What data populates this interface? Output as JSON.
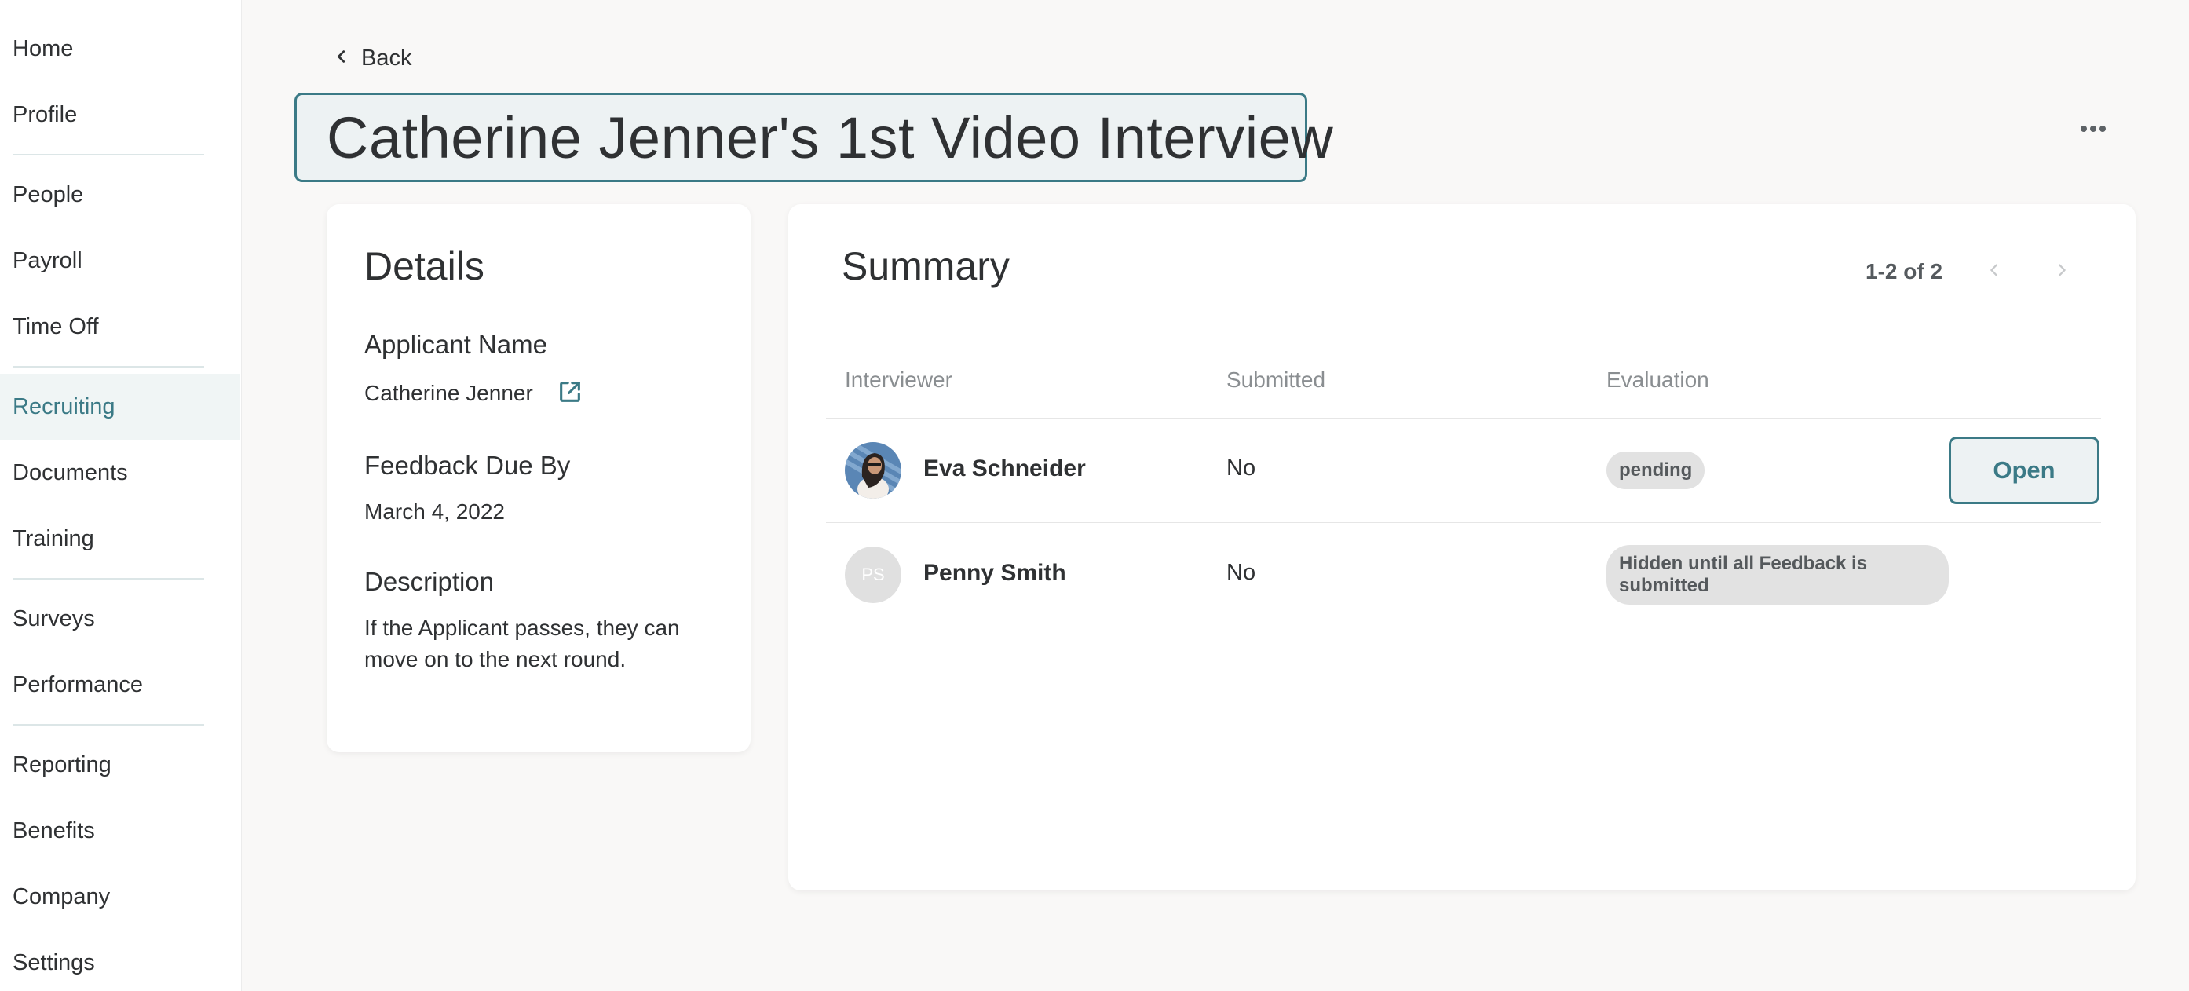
{
  "sidebar": {
    "items": [
      {
        "label": "Home"
      },
      {
        "label": "Profile"
      },
      {
        "label": "People"
      },
      {
        "label": "Payroll"
      },
      {
        "label": "Time Off"
      },
      {
        "label": "Recruiting"
      },
      {
        "label": "Documents"
      },
      {
        "label": "Training"
      },
      {
        "label": "Surveys"
      },
      {
        "label": "Performance"
      },
      {
        "label": "Reporting"
      },
      {
        "label": "Benefits"
      },
      {
        "label": "Company"
      },
      {
        "label": "Settings"
      }
    ],
    "active_item": "Recruiting"
  },
  "header": {
    "back_label": "Back",
    "title": "Catherine Jenner's 1st Video Interview",
    "more_icon": "more-horizontal-icon"
  },
  "details": {
    "title": "Details",
    "applicant_label": "Applicant Name",
    "applicant_value": "Catherine Jenner",
    "feedback_label": "Feedback Due By",
    "feedback_value": "March 4, 2022",
    "description_label": "Description",
    "description_value": "If the Applicant passes, they can move on to the next round."
  },
  "summary": {
    "title": "Summary",
    "pagination": "1-2 of 2",
    "columns": [
      "Interviewer",
      "Submitted",
      "Evaluation"
    ],
    "rows": [
      {
        "name": "Eva Schneider",
        "submitted": "No",
        "evaluation": "pending",
        "action": "Open"
      },
      {
        "name": "Penny Smith",
        "initials": "PS",
        "submitted": "No",
        "evaluation": "Hidden until all Feedback is submitted"
      }
    ]
  },
  "colors": {
    "accent": "#3b7a86",
    "accent_bg": "#edf2f3",
    "page_bg": "#f9f8f7",
    "badge_bg": "#e2e2e2"
  }
}
